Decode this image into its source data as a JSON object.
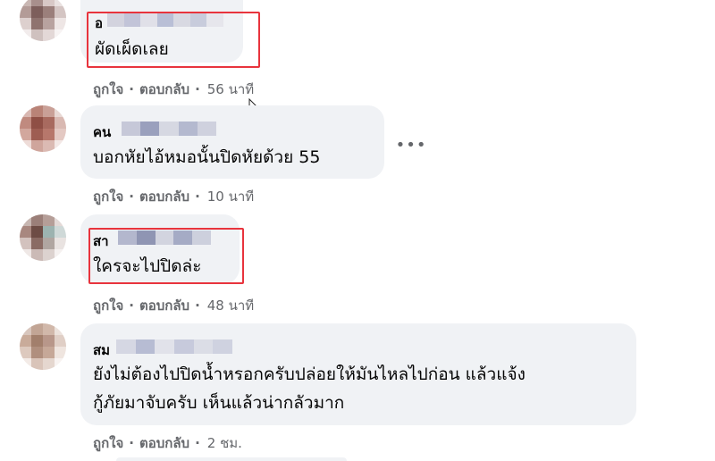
{
  "comments": [
    {
      "author_visible": "อ",
      "text_lines": [
        "ผัดเผ็ดเลย"
      ],
      "like_label": "ถูกใจ",
      "reply_label": "ตอบกลับ",
      "time": "56 นาที"
    },
    {
      "author_visible": "คน",
      "text_lines": [
        "บอกหัยไอ้หมอนั้นปิดหัยด้วย 55"
      ],
      "like_label": "ถูกใจ",
      "reply_label": "ตอบกลับ",
      "time": "10 นาที"
    },
    {
      "author_visible": "สา",
      "text_lines": [
        "ใครจะไปปิดล่ะ"
      ],
      "like_label": "ถูกใจ",
      "reply_label": "ตอบกลับ",
      "time": "48 นาที"
    },
    {
      "author_visible": "สม",
      "text_lines": [
        "ยังไม่ต้องไปปิดน้ำหรอกครับปล่อยให้มันไหลไปก่อน แล้วแจ้ง",
        "กู้ภัยมาจับครับ เห็นแล้วน่ากลัวมาก"
      ],
      "like_label": "ถูกใจ",
      "reply_label": "ตอบกลับ",
      "time": "2 ชม."
    }
  ],
  "separator": "·",
  "icons": {
    "more": "more-options-icon",
    "cursor": "mouse-cursor-icon"
  },
  "colors": {
    "bubble": "#f0f2f5",
    "highlight": "#e8343d",
    "meta_text": "#65676b"
  }
}
